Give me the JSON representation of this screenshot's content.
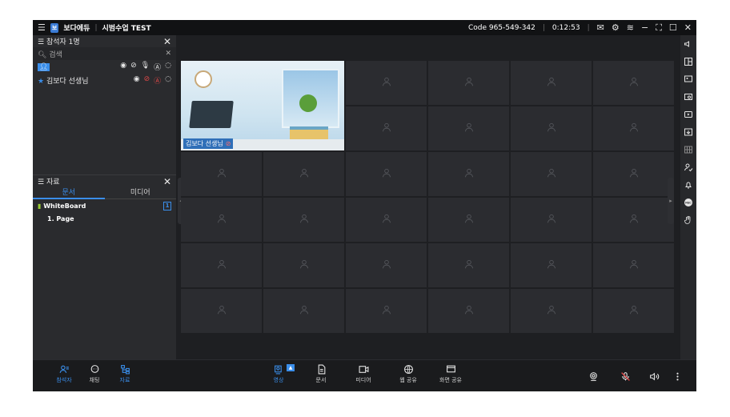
{
  "titlebar": {
    "logo_text": "보",
    "brand": "보다에듀",
    "session_title": "시범수업 TEST",
    "code": "Code 965-549-342",
    "timer": "0:12:53"
  },
  "participants": {
    "header": "참석자 1명",
    "search_placeholder": "검색",
    "rows": [
      {
        "name": "김보다 선생님"
      }
    ]
  },
  "materials": {
    "header": "자료",
    "tabs": [
      "문서",
      "미디어"
    ],
    "docs": [
      {
        "name": "WhiteBoard",
        "count": "1"
      },
      {
        "name": "1. Page",
        "count": ""
      }
    ]
  },
  "video": {
    "label": "김보다 선생님"
  },
  "bottom": {
    "left_items": [
      {
        "label": "참석자"
      },
      {
        "label": "채팅"
      },
      {
        "label": "자료"
      }
    ],
    "center_items": [
      {
        "label": "영상"
      },
      {
        "label": "문서"
      },
      {
        "label": "미디어"
      },
      {
        "label": "웹 공유"
      },
      {
        "label": "화면 공유"
      }
    ]
  },
  "colors": {
    "accent": "#3a8eea",
    "background": "#1e1f22",
    "panel": "#2a2b2e",
    "danger": "#e04848"
  }
}
